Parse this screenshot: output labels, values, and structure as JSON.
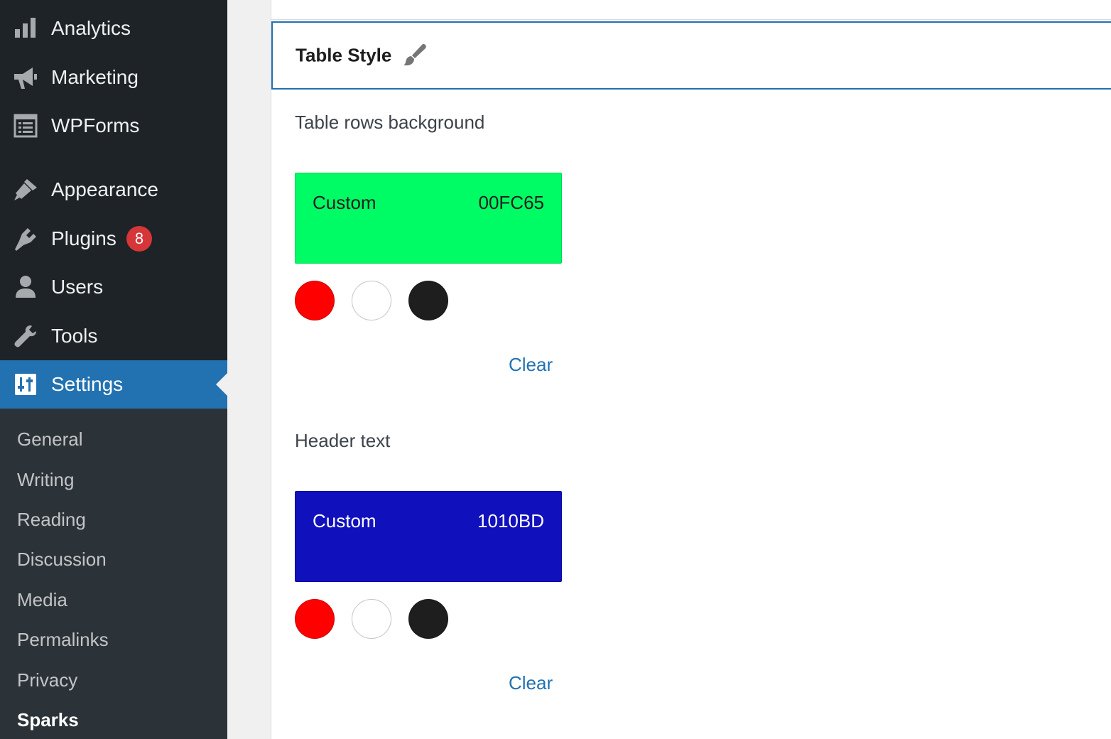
{
  "sidebar": {
    "items": [
      {
        "label": "Analytics",
        "icon": "bar-chart-icon"
      },
      {
        "label": "Marketing",
        "icon": "megaphone-icon"
      },
      {
        "label": "WPForms",
        "icon": "form-icon"
      },
      {
        "label": "Appearance",
        "icon": "paintbrush-icon"
      },
      {
        "label": "Plugins",
        "icon": "plug-icon",
        "badge": "8"
      },
      {
        "label": "Users",
        "icon": "user-icon"
      },
      {
        "label": "Tools",
        "icon": "wrench-icon"
      },
      {
        "label": "Settings",
        "icon": "settings-icon",
        "active": true
      }
    ],
    "submenu": [
      {
        "label": "General"
      },
      {
        "label": "Writing"
      },
      {
        "label": "Reading"
      },
      {
        "label": "Discussion"
      },
      {
        "label": "Media"
      },
      {
        "label": "Permalinks"
      },
      {
        "label": "Privacy"
      },
      {
        "label": "Sparks",
        "current": true
      }
    ]
  },
  "panel": {
    "section_title": "Table Style",
    "section_icon": "brush-icon",
    "fields": [
      {
        "label": "Table rows background",
        "swatch_name": "Custom",
        "swatch_hex": "00FC65",
        "swatch_color": "#00fc65",
        "swatch_text_color": "#1e1e1e",
        "presets": [
          "#ff0000",
          "#ffffff",
          "#1e1e1e"
        ],
        "clear_label": "Clear"
      },
      {
        "label": "Header text",
        "swatch_name": "Custom",
        "swatch_hex": "1010BD",
        "swatch_color": "#1010bd",
        "swatch_text_color": "#ffffff",
        "presets": [
          "#ff0000",
          "#ffffff",
          "#1e1e1e"
        ],
        "clear_label": "Clear"
      }
    ]
  },
  "colors": {
    "sidebar_bg": "#1d2327",
    "submenu_bg": "#2c3338",
    "accent": "#2271b1",
    "badge": "#d63638"
  }
}
